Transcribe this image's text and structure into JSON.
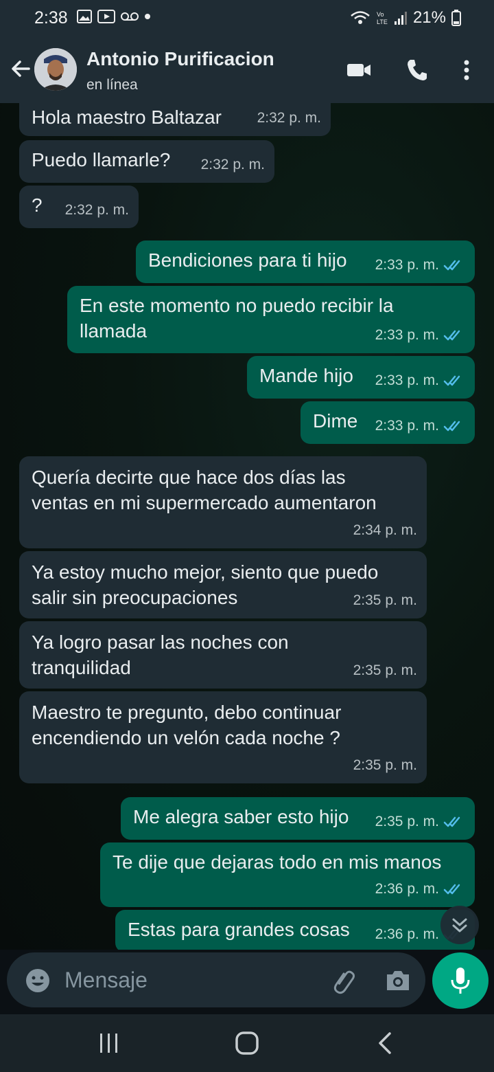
{
  "status_bar": {
    "time": "2:38",
    "battery": "21%"
  },
  "header": {
    "contact_name": "Antonio Purificacion",
    "status": "en línea"
  },
  "messages": [
    {
      "dir": "in",
      "text": "Hola maestro Baltazar",
      "time": "2:32 p. m."
    },
    {
      "dir": "in",
      "text": "Puedo llamarle?",
      "time": "2:32 p. m."
    },
    {
      "dir": "in",
      "text": "?",
      "time": "2:32 p. m."
    },
    {
      "dir": "out",
      "text": "Bendiciones para ti hijo",
      "time": "2:33 p. m."
    },
    {
      "dir": "out",
      "text": "En este momento no puedo recibir la\nllamada",
      "time": "2:33 p. m."
    },
    {
      "dir": "out",
      "text": "Mande hijo",
      "time": "2:33 p. m."
    },
    {
      "dir": "out",
      "text": "Dime",
      "time": "2:33 p. m."
    },
    {
      "dir": "in",
      "text": "Quería decirte que hace dos días las\nventas en mi supermercado aumentaron",
      "time": "2:34 p. m."
    },
    {
      "dir": "in",
      "text": "Ya estoy mucho mejor, siento que puedo\nsalir sin preocupaciones",
      "time": "2:35 p. m."
    },
    {
      "dir": "in",
      "text": "Ya logro pasar las noches con\ntranquilidad",
      "time": "2:35 p. m."
    },
    {
      "dir": "in",
      "text": "Maestro te pregunto, debo continuar\nencendiendo un velón cada noche ?",
      "time": "2:35 p. m."
    },
    {
      "dir": "out",
      "text": "Me alegra saber esto hijo",
      "time": "2:35 p. m."
    },
    {
      "dir": "out",
      "text": "Te dije que dejaras todo en mis manos",
      "time": "2:36 p. m."
    },
    {
      "dir": "out",
      "text": "Estas para grandes cosas",
      "time": "2:36 p. m."
    }
  ],
  "composer": {
    "placeholder": "Mensaje"
  },
  "colors": {
    "incoming_bubble": "#1f2c34",
    "outgoing_bubble": "#005c4b",
    "accent": "#00a884",
    "read_ticks": "#53bdeb"
  },
  "icons": {
    "status_left": [
      "gallery-icon",
      "youtube-icon",
      "voicemail-icon",
      "dot-icon"
    ],
    "status_right": [
      "wifi-icon",
      "volte-icon",
      "signal-icon",
      "battery-icon"
    ],
    "header": [
      "back-arrow-icon",
      "video-call-icon",
      "voice-call-icon",
      "more-vert-icon"
    ],
    "composer": [
      "emoji-icon",
      "attach-icon",
      "camera-icon",
      "mic-icon"
    ],
    "nav": [
      "recents-icon",
      "home-icon",
      "back-icon"
    ]
  }
}
